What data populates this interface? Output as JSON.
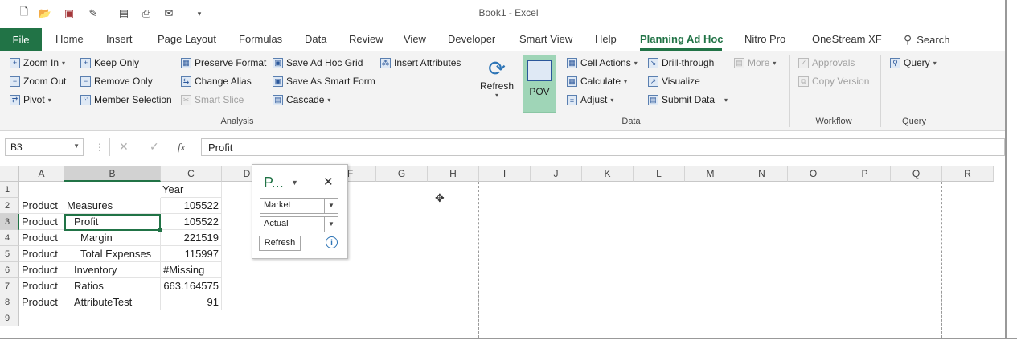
{
  "window": {
    "title": "Book1  -  Excel"
  },
  "tabs": [
    "File",
    "Home",
    "Insert",
    "Page Layout",
    "Formulas",
    "Data",
    "Review",
    "View",
    "Developer",
    "Smart View",
    "Help",
    "Planning Ad Hoc",
    "Nitro Pro",
    "OneStream XF"
  ],
  "search_label": "Search",
  "ribbon": {
    "analysis": {
      "zoom_in": "Zoom In",
      "zoom_out": "Zoom Out",
      "pivot": "Pivot",
      "keep_only": "Keep Only",
      "remove_only": "Remove Only",
      "member_selection": "Member Selection",
      "preserve_format": "Preserve Format",
      "change_alias": "Change Alias",
      "smart_slice": "Smart Slice",
      "save_adhoc_grid": "Save Ad Hoc Grid",
      "save_as_smart_form": "Save As Smart Form",
      "cascade": "Cascade",
      "insert_attributes": "Insert Attributes",
      "label": "Analysis"
    },
    "data": {
      "refresh": "Refresh",
      "pov": "POV",
      "cell_actions": "Cell Actions",
      "calculate": "Calculate",
      "adjust": "Adjust",
      "drill_through": "Drill-through",
      "visualize": "Visualize",
      "submit_data": "Submit Data",
      "more": "More",
      "label": "Data"
    },
    "workflow": {
      "approvals": "Approvals",
      "copy_version": "Copy Version",
      "label": "Workflow"
    },
    "query": {
      "query": "Query",
      "label": "Query"
    }
  },
  "formula_bar": {
    "name_box": "B3",
    "fx": "fx",
    "formula": "Profit"
  },
  "grid": {
    "columns": [
      "A",
      "B",
      "C",
      "D",
      "E",
      "F",
      "G",
      "H",
      "I",
      "J",
      "K",
      "L",
      "M",
      "N",
      "O",
      "P",
      "Q",
      "R"
    ],
    "rows": [
      "1",
      "2",
      "3",
      "4",
      "5",
      "6",
      "7",
      "8",
      "9"
    ],
    "cells": {
      "C1": "Year",
      "A2": "Product",
      "B2": "Measures",
      "C2": "105522",
      "A3": "Product",
      "B3": "Profit",
      "C3": "105522",
      "A4": "Product",
      "B4": "Margin",
      "C4": "221519",
      "A5": "Product",
      "B5": "Total Expenses",
      "C5": "115997",
      "A6": "Product",
      "B6": "Inventory",
      "C6": "#Missing",
      "A7": "Product",
      "B7": "Ratios",
      "C7": "663.164575",
      "A8": "Product",
      "B8": "AttributeTest",
      "C8": "91"
    }
  },
  "pov_popup": {
    "title": "P...",
    "dim1": "Market",
    "dim2": "Actual",
    "refresh": "Refresh"
  }
}
